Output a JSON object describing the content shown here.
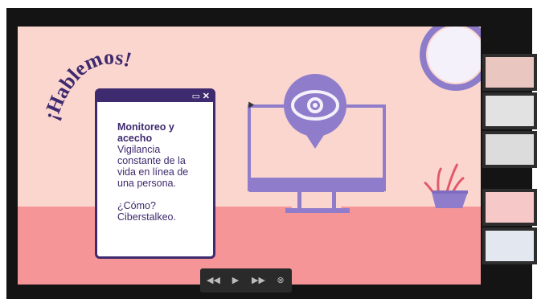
{
  "slide": {
    "title": "¡Hablemos!",
    "window": {
      "heading": "Monitoreo y acecho",
      "description": "Vigilancia constante de la vida en línea de una persona.",
      "question": "¿Cómo?",
      "answer": "Ciberstalkeo.",
      "minimize_icon": "minimize-icon",
      "close_icon": "close-icon"
    }
  },
  "controls": {
    "prev_icon": "rewind-icon",
    "play_icon": "play-icon",
    "next_icon": "fast-forward-icon",
    "close_icon": "close-circle-icon"
  },
  "participants_count": 5
}
